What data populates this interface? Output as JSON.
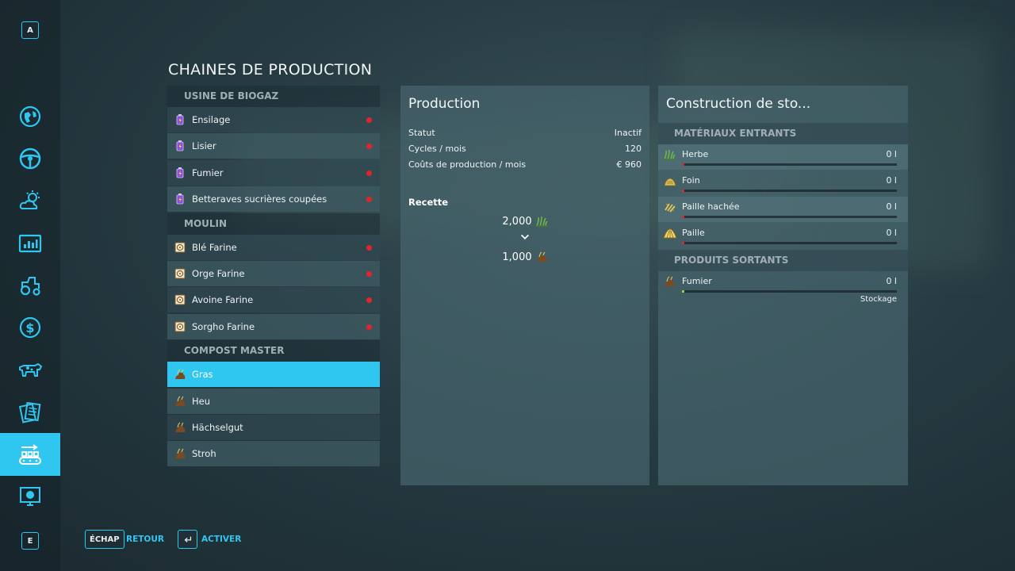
{
  "sidebar": {
    "top_key": "A",
    "bottom_key": "E",
    "items": [
      {
        "icon": "map-icon"
      },
      {
        "icon": "steering-wheel-icon"
      },
      {
        "icon": "weather-icon"
      },
      {
        "icon": "statistics-icon"
      },
      {
        "icon": "tractor-icon"
      },
      {
        "icon": "finances-icon"
      },
      {
        "icon": "animals-icon"
      },
      {
        "icon": "contracts-icon"
      },
      {
        "icon": "production-icon",
        "active": true
      },
      {
        "icon": "help-icon"
      }
    ]
  },
  "page": {
    "title": "CHAINES DE PRODUCTION"
  },
  "chains": {
    "groups": [
      {
        "name": "USINE DE BIOGAZ",
        "items": [
          {
            "label": "Ensilage",
            "icon": "biogas-icon"
          },
          {
            "label": "Lisier",
            "icon": "biogas-icon"
          },
          {
            "label": "Fumier",
            "icon": "biogas-icon"
          },
          {
            "label": "Betteraves sucrières coupées",
            "icon": "biogas-icon"
          }
        ]
      },
      {
        "name": "MOULIN",
        "items": [
          {
            "label": "Blé Farine",
            "icon": "flour-icon"
          },
          {
            "label": "Orge Farine",
            "icon": "flour-icon"
          },
          {
            "label": "Avoine Farine",
            "icon": "flour-icon"
          },
          {
            "label": "Sorgho Farine",
            "icon": "flour-icon"
          }
        ]
      },
      {
        "name": "COMPOST MASTER",
        "items": [
          {
            "label": "Gras",
            "icon": "manure-icon",
            "selected": true
          },
          {
            "label": "Heu",
            "icon": "manure-icon"
          },
          {
            "label": "Hächselgut",
            "icon": "manure-icon"
          },
          {
            "label": "Stroh",
            "icon": "manure-icon"
          }
        ]
      }
    ]
  },
  "production": {
    "title": "Production",
    "stats": [
      {
        "label": "Statut",
        "value": "Inactif"
      },
      {
        "label": "Cycles / mois",
        "value": "120"
      },
      {
        "label": "Coûts de production / mois",
        "value": "€ 960"
      }
    ],
    "recipe_label": "Recette",
    "recipe_input": "2,000",
    "recipe_output": "1,000"
  },
  "storage": {
    "title": "Construction de sto...",
    "inputs_header": "MATÉRIAUX ENTRANTS",
    "outputs_header": "PRODUITS SORTANTS",
    "inputs": [
      {
        "name": "Herbe",
        "amount": "0 l",
        "icon": "grass-icon",
        "fill": 0
      },
      {
        "name": "Foin",
        "amount": "0 l",
        "icon": "hay-icon",
        "fill": 0
      },
      {
        "name": "Paille hachée",
        "amount": "0 l",
        "icon": "chopped-straw-icon",
        "fill": 0
      },
      {
        "name": "Paille",
        "amount": "0 l",
        "icon": "straw-icon",
        "fill": 0
      }
    ],
    "outputs": [
      {
        "name": "Fumier",
        "amount": "0 l",
        "icon": "manure-icon",
        "fill": 0,
        "mode": "Stockage"
      }
    ]
  },
  "footer": {
    "back_key": "ÉCHAP",
    "back_label": "RETOUR",
    "activate_label": "ACTIVER"
  },
  "colors": {
    "accent": "#2fc6f0",
    "inactive_dot": "#e0262b",
    "output_bar": "#8fd14a"
  }
}
